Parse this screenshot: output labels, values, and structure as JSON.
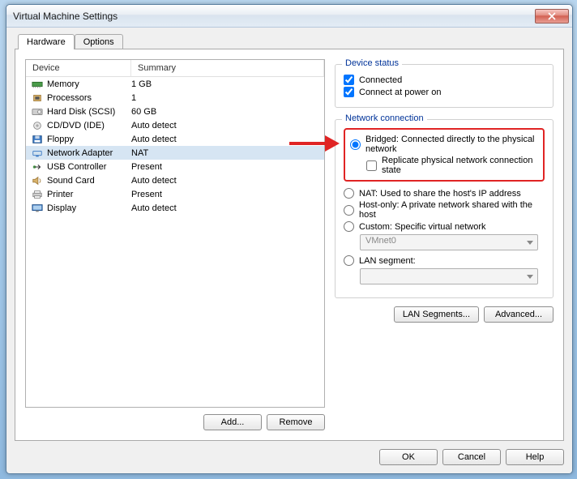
{
  "window": {
    "title": "Virtual Machine Settings"
  },
  "tabs": [
    {
      "label": "Hardware",
      "active": true
    },
    {
      "label": "Options",
      "active": false
    }
  ],
  "deviceList": {
    "headers": {
      "device": "Device",
      "summary": "Summary"
    },
    "rows": [
      {
        "icon": "memory",
        "name": "Memory",
        "summary": "1 GB"
      },
      {
        "icon": "cpu",
        "name": "Processors",
        "summary": "1"
      },
      {
        "icon": "hdd",
        "name": "Hard Disk (SCSI)",
        "summary": "60 GB"
      },
      {
        "icon": "cd",
        "name": "CD/DVD (IDE)",
        "summary": "Auto detect"
      },
      {
        "icon": "floppy",
        "name": "Floppy",
        "summary": "Auto detect"
      },
      {
        "icon": "net",
        "name": "Network Adapter",
        "summary": "NAT",
        "selected": true
      },
      {
        "icon": "usb",
        "name": "USB Controller",
        "summary": "Present"
      },
      {
        "icon": "sound",
        "name": "Sound Card",
        "summary": "Auto detect"
      },
      {
        "icon": "printer",
        "name": "Printer",
        "summary": "Present"
      },
      {
        "icon": "display",
        "name": "Display",
        "summary": "Auto detect"
      }
    ]
  },
  "leftButtons": {
    "add": "Add...",
    "remove": "Remove"
  },
  "deviceStatus": {
    "legend": "Device status",
    "connected": {
      "label": "Connected",
      "checked": true
    },
    "poweron": {
      "label": "Connect at power on",
      "checked": true
    }
  },
  "netConn": {
    "legend": "Network connection",
    "bridged": {
      "label": "Bridged: Connected directly to the physical network",
      "selected": true
    },
    "replicate": {
      "label": "Replicate physical network connection state",
      "checked": false
    },
    "nat": {
      "label": "NAT: Used to share the host's IP address",
      "selected": false
    },
    "hostonly": {
      "label": "Host-only: A private network shared with the host",
      "selected": false
    },
    "custom": {
      "label": "Custom: Specific virtual network",
      "selected": false
    },
    "customCombo": "VMnet0",
    "lanseg": {
      "label": "LAN segment:",
      "selected": false
    },
    "lanCombo": ""
  },
  "rightButtons": {
    "lan": "LAN Segments...",
    "adv": "Advanced..."
  },
  "footer": {
    "ok": "OK",
    "cancel": "Cancel",
    "help": "Help"
  }
}
